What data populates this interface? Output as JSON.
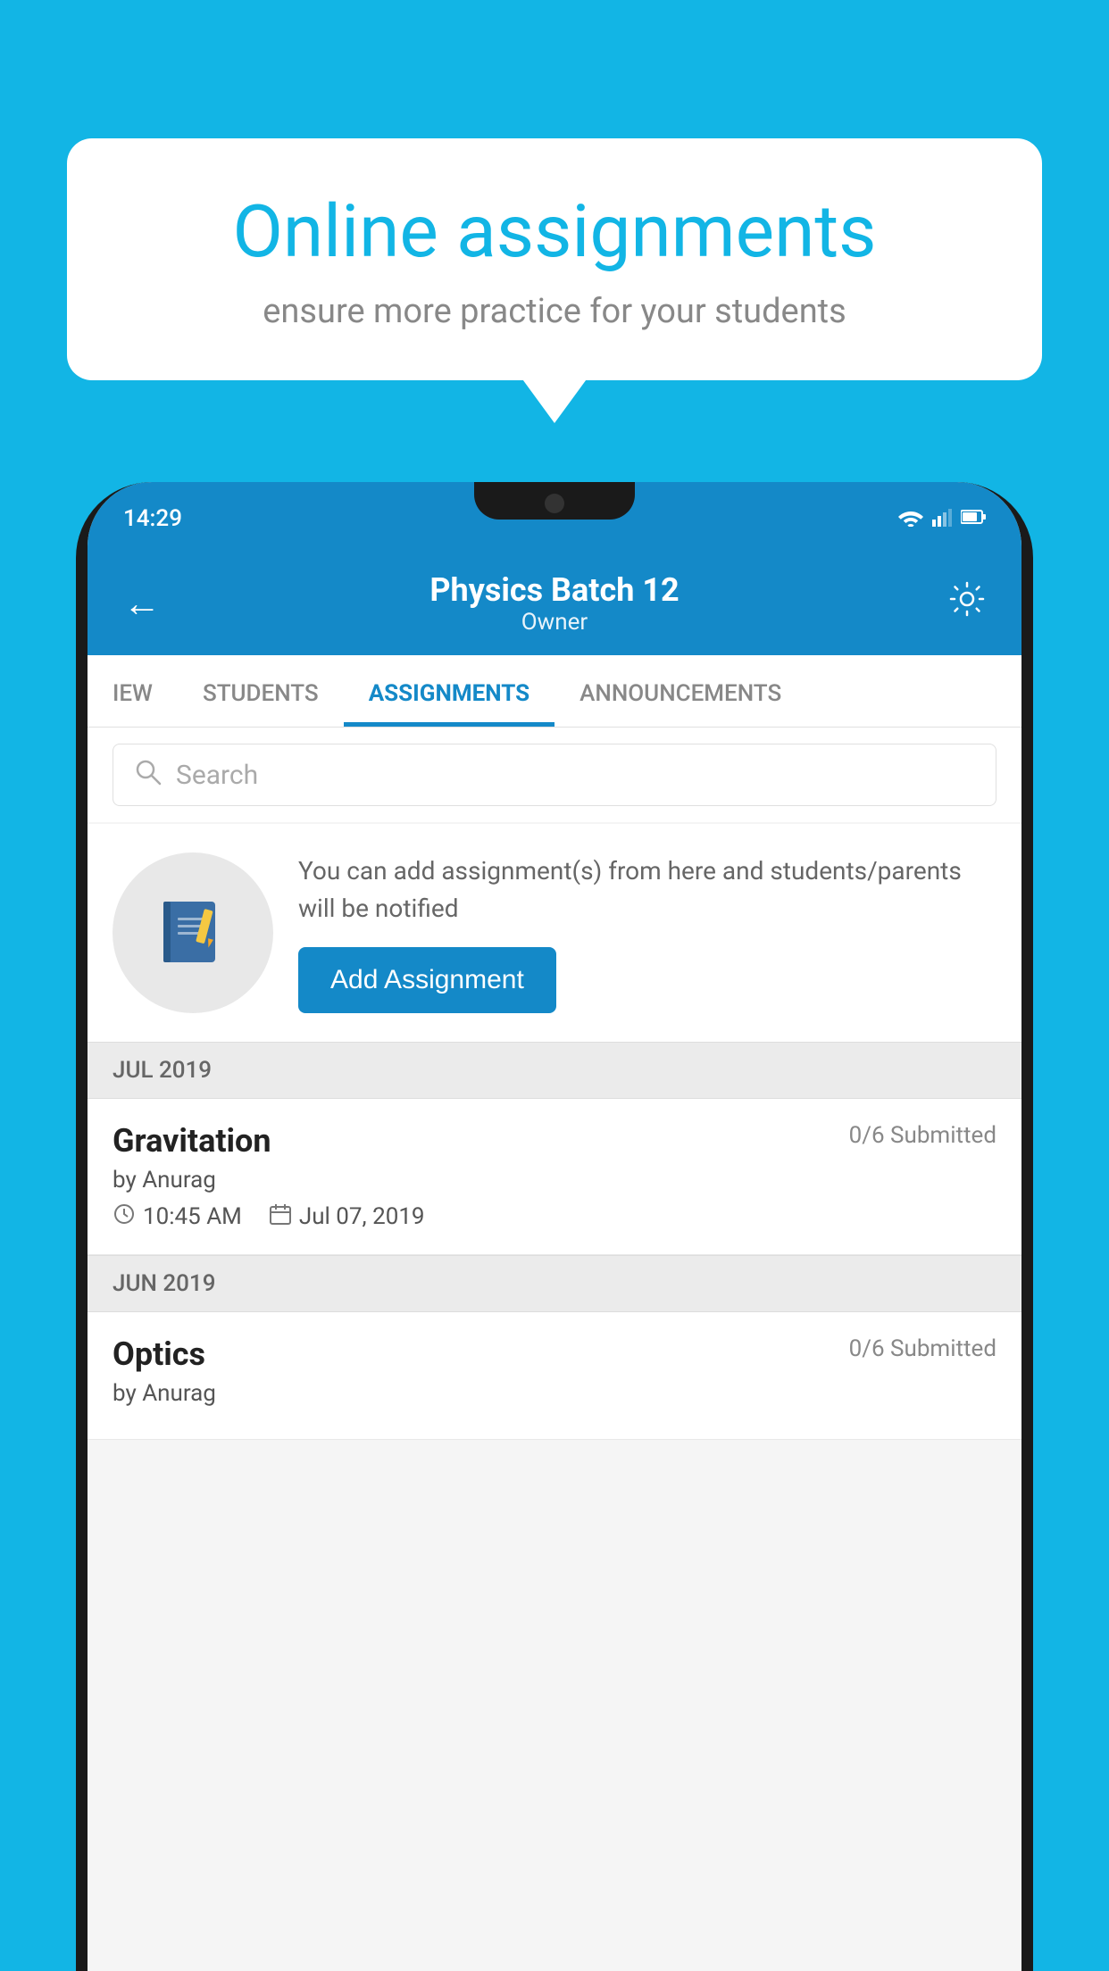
{
  "background_color": "#12B5E5",
  "bubble": {
    "title": "Online assignments",
    "subtitle": "ensure more practice for your students"
  },
  "phone": {
    "status_bar": {
      "time": "14:29",
      "wifi": "▾",
      "signal": "▲",
      "battery": "▮"
    },
    "header": {
      "title": "Physics Batch 12",
      "subtitle": "Owner",
      "back_label": "←",
      "settings_label": "⚙"
    },
    "tabs": [
      {
        "id": "overview",
        "label": "IEW",
        "active": false
      },
      {
        "id": "students",
        "label": "STUDENTS",
        "active": false
      },
      {
        "id": "assignments",
        "label": "ASSIGNMENTS",
        "active": true
      },
      {
        "id": "announcements",
        "label": "ANNOUNCEMENTS",
        "active": false
      }
    ],
    "search": {
      "placeholder": "Search"
    },
    "promo": {
      "description": "You can add assignment(s) from here and students/parents will be notified",
      "button_label": "Add Assignment"
    },
    "sections": [
      {
        "label": "JUL 2019",
        "assignments": [
          {
            "name": "Gravitation",
            "submitted": "0/6 Submitted",
            "by": "by Anurag",
            "time": "10:45 AM",
            "date": "Jul 07, 2019"
          }
        ]
      },
      {
        "label": "JUN 2019",
        "assignments": [
          {
            "name": "Optics",
            "submitted": "0/6 Submitted",
            "by": "by Anurag",
            "time": "",
            "date": ""
          }
        ]
      }
    ]
  }
}
